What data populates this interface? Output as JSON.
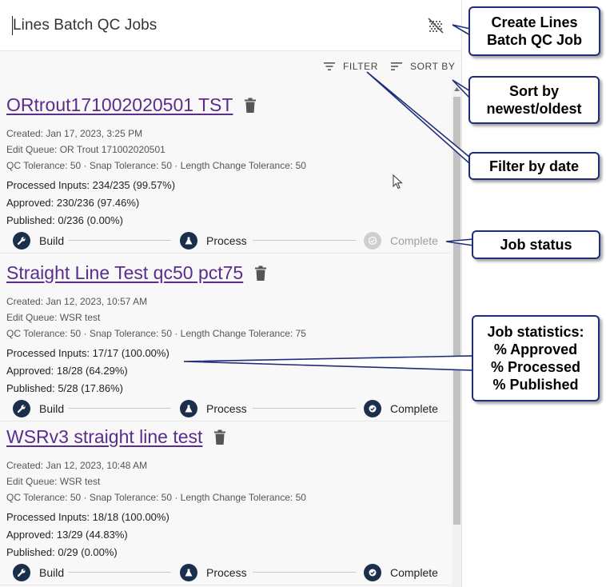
{
  "header": {
    "title": "Lines Batch QC Jobs",
    "create_icon": "batch-qc-add-icon"
  },
  "toolbar": {
    "filter_label": "FILTER",
    "sort_label": "SORT BY"
  },
  "jobs": [
    {
      "title": "ORtrout171002020501 TST",
      "created": "Created: Jan 17, 2023, 3:25 PM",
      "edit_queue": "Edit Queue: OR Trout 171002020501",
      "tolerances": "QC Tolerance: 50 · Snap Tolerance: 50 · Length Change Tolerance: 50",
      "processed": "Processed Inputs: 234/235 (99.57%)",
      "approved": "Approved: 230/236 (97.46%)",
      "published": "Published: 0/236 (0.00%)",
      "steps": [
        "Build",
        "Process",
        "Complete"
      ],
      "complete_done": false
    },
    {
      "title": "Straight Line Test qc50 pct75",
      "created": "Created: Jan 12, 2023, 10:57 AM",
      "edit_queue": "Edit Queue: WSR test",
      "tolerances": "QC Tolerance: 50 · Snap Tolerance: 50 · Length Change Tolerance: 75",
      "processed": "Processed Inputs: 17/17 (100.00%)",
      "approved": "Approved: 18/28 (64.29%)",
      "published": "Published: 5/28 (17.86%)",
      "steps": [
        "Build",
        "Process",
        "Complete"
      ],
      "complete_done": true
    },
    {
      "title": "WSRv3 straight line test",
      "created": "Created: Jan 12, 2023, 10:48 AM",
      "edit_queue": "Edit Queue: WSR test",
      "tolerances": "QC Tolerance: 50 · Snap Tolerance: 50 · Length Change Tolerance: 50",
      "processed": "Processed Inputs: 18/18 (100.00%)",
      "approved": "Approved: 13/29 (44.83%)",
      "published": "Published: 0/29 (0.00%)",
      "steps": [
        "Build",
        "Process",
        "Complete"
      ],
      "complete_done": true
    }
  ],
  "callouts": {
    "create_line1": "Create Lines",
    "create_line2": "Batch QC Job",
    "sort_line1": "Sort by",
    "sort_line2": "newest/oldest",
    "filter": "Filter by date",
    "status": "Job status",
    "stats_line1": "Job statistics:",
    "stats_line2": "% Approved",
    "stats_line3": "% Processed",
    "stats_line4": "% Published"
  },
  "colors": {
    "link": "#5a2d8c",
    "step_active": "#1b2e4b",
    "step_inactive": "#cfcfcf",
    "callout_border": "#1f2d7a"
  }
}
